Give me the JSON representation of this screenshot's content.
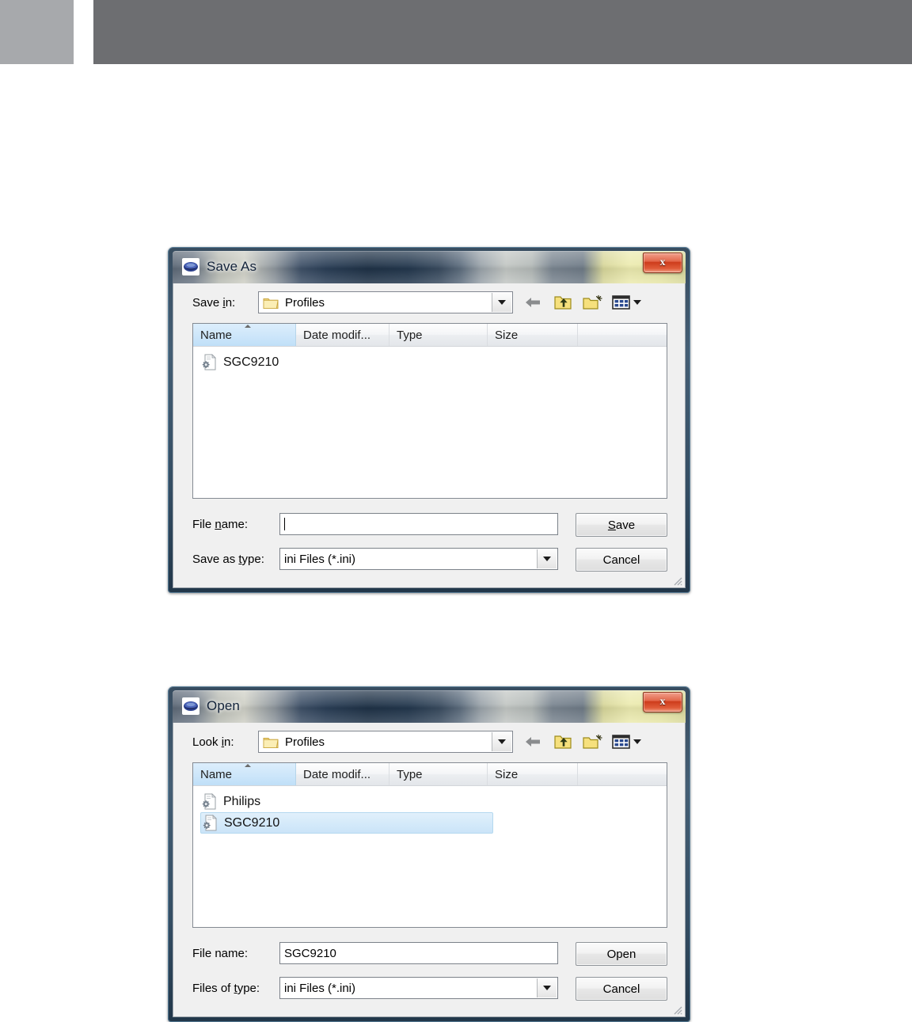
{
  "header": {
    "left_block_color": "#a7a9ac",
    "band_color": "#6d6e71"
  },
  "dialogs": [
    {
      "id": "save-as",
      "title": "Save As",
      "app_icon": "philips-oval-icon",
      "close_label": "x",
      "nav": {
        "label_prefix": "Save ",
        "label_accel": "i",
        "label_suffix": "n:",
        "label_full": "Save in:",
        "folder_value": "Profiles",
        "tools": [
          {
            "name": "back-arrow-icon",
            "tooltip": "Back"
          },
          {
            "name": "up-folder-icon",
            "tooltip": "Up One Level"
          },
          {
            "name": "new-folder-icon",
            "tooltip": "Create New Folder"
          },
          {
            "name": "views-icon",
            "tooltip": "Views"
          }
        ]
      },
      "columns": [
        "Name",
        "Date modif...",
        "Type",
        "Size"
      ],
      "sorted_column": "Name",
      "files": [
        {
          "name": "SGC9210",
          "icon": "ini-file-icon",
          "selected": false
        }
      ],
      "filename": {
        "label_prefix": "File ",
        "label_accel": "n",
        "label_suffix": "ame:",
        "label_full": "File name:",
        "value": "",
        "placeholder": ""
      },
      "filetype": {
        "label_prefix": "Save as ",
        "label_accel": "t",
        "label_suffix": "ype:",
        "label_full": "Save as type:",
        "value": "ini Files (*.ini)"
      },
      "primary_button": {
        "prefix": "",
        "accel": "S",
        "suffix": "ave",
        "full": "Save"
      },
      "secondary_button": {
        "full": "Cancel"
      }
    },
    {
      "id": "open",
      "title": "Open",
      "app_icon": "philips-oval-icon",
      "close_label": "x",
      "nav": {
        "label_prefix": "Look ",
        "label_accel": "i",
        "label_suffix": "n:",
        "label_full": "Look in:",
        "folder_value": "Profiles",
        "tools": [
          {
            "name": "back-arrow-icon",
            "tooltip": "Back"
          },
          {
            "name": "up-folder-icon",
            "tooltip": "Up One Level"
          },
          {
            "name": "new-folder-icon",
            "tooltip": "Create New Folder"
          },
          {
            "name": "views-icon",
            "tooltip": "Views"
          }
        ]
      },
      "columns": [
        "Name",
        "Date modif...",
        "Type",
        "Size"
      ],
      "sorted_column": "Name",
      "files": [
        {
          "name": "Philips",
          "icon": "ini-file-icon",
          "selected": false
        },
        {
          "name": "SGC9210",
          "icon": "ini-file-icon",
          "selected": true
        }
      ],
      "filename": {
        "label_prefix": "File ",
        "label_accel": "n",
        "label_suffix": "ame:",
        "label_full": "File name:",
        "value": "SGC9210",
        "placeholder": ""
      },
      "filetype": {
        "label_prefix": "Files of ",
        "label_accel": "t",
        "label_suffix": "ype:",
        "label_full": "Files of type:",
        "value": "ini Files (*.ini)"
      },
      "primary_button": {
        "prefix": "",
        "accel": "",
        "suffix": "",
        "full": "Open"
      },
      "secondary_button": {
        "full": "Cancel"
      }
    }
  ],
  "colors": {
    "selection_blue": "#cbe4f8",
    "sorted_header_blue": "#cfe7fa",
    "close_red": "#cd3c1c",
    "folder_yellow": "#f5e27a",
    "frame_blue": "#24384e"
  }
}
